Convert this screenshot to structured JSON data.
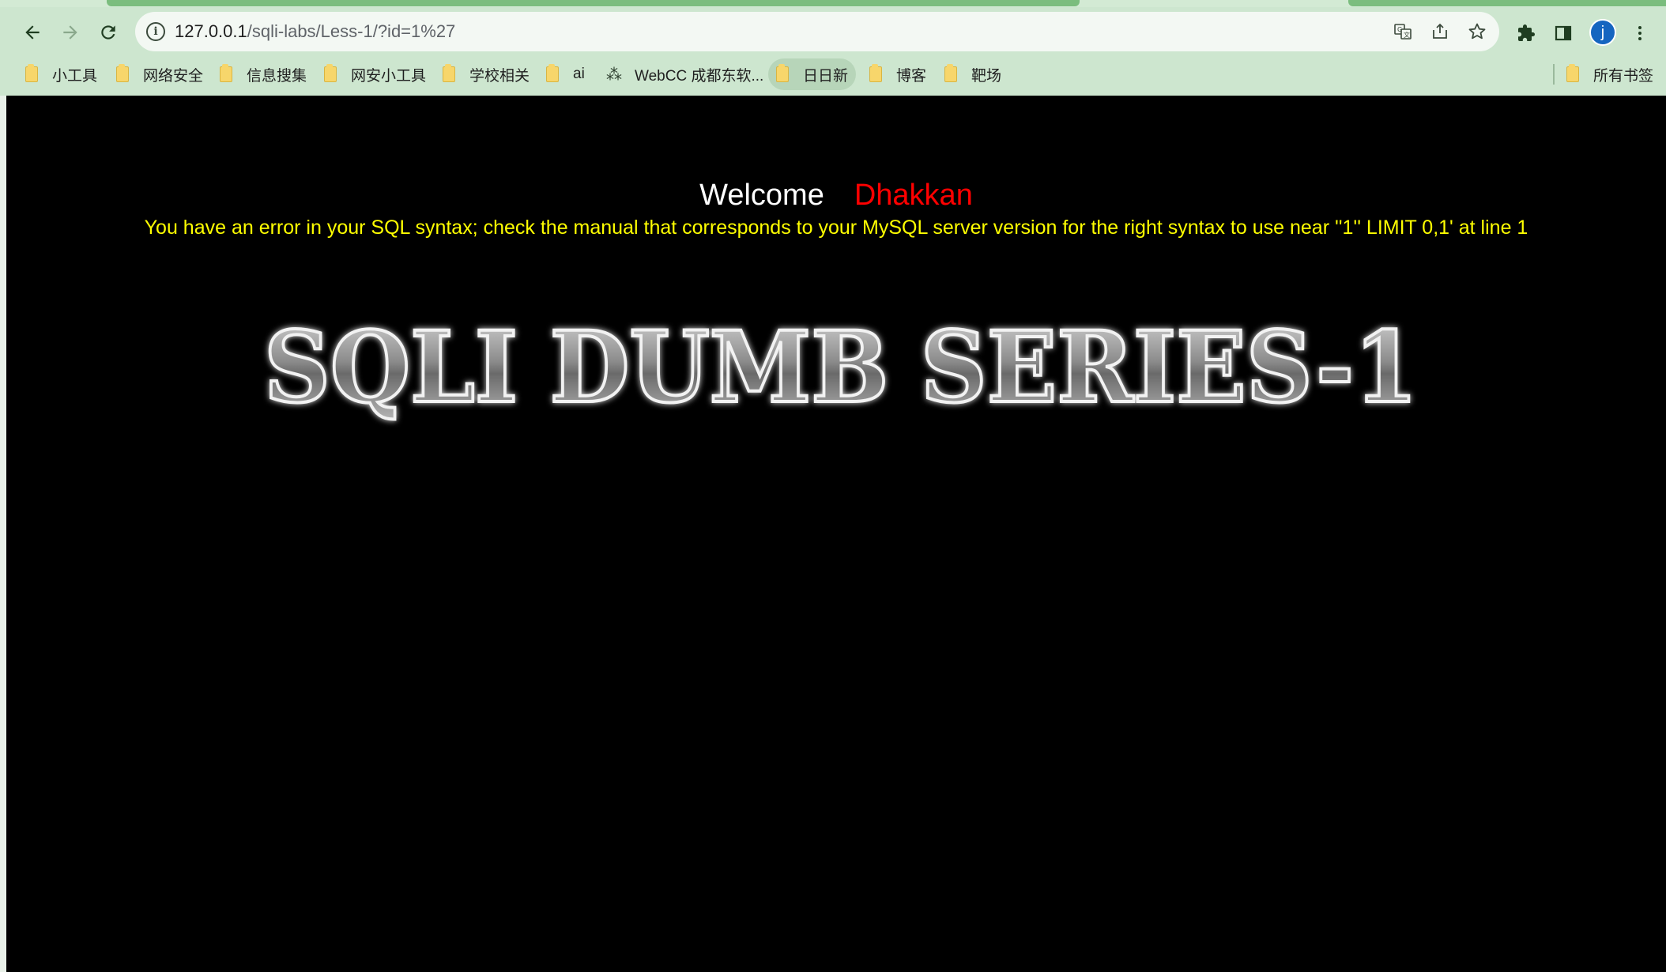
{
  "browser": {
    "url_host": "127.0.0.1",
    "url_path": "/sqli-labs/Less-1/?id=1%27",
    "avatar_letter": "j",
    "icons": {
      "back": "back-arrow-icon",
      "forward": "forward-arrow-icon",
      "reload": "reload-icon",
      "info": "site-info-icon",
      "translate": "translate-icon",
      "share": "share-icon",
      "star": "bookmark-star-icon",
      "extensions": "puzzle-icon",
      "sidepanel": "side-panel-icon",
      "menu": "kebab-menu-icon"
    }
  },
  "bookmarks": {
    "items": [
      {
        "label": "小工具"
      },
      {
        "label": "网络安全"
      },
      {
        "label": "信息搜集"
      },
      {
        "label": "网安小工具"
      },
      {
        "label": "学校相关"
      },
      {
        "label": "ai"
      },
      {
        "label": "WebCC 成都东软..."
      },
      {
        "label": "日日新"
      },
      {
        "label": "博客"
      },
      {
        "label": "靶场"
      }
    ],
    "all_bookmarks": "所有书签"
  },
  "page": {
    "welcome": "Welcome",
    "username": "Dhakkan",
    "error": "You have an error in your SQL syntax; check the manual that corresponds to your MySQL server version for the right syntax to use near ''1'' LIMIT 0,1' at line 1",
    "banner": "SQLI DUMB SERIES-1"
  },
  "colors": {
    "page_background": "#000000",
    "welcome_text": "#ffffff",
    "username_text": "#ff0000",
    "error_text": "#ffff00",
    "chrome_background": "#cde6cf"
  }
}
